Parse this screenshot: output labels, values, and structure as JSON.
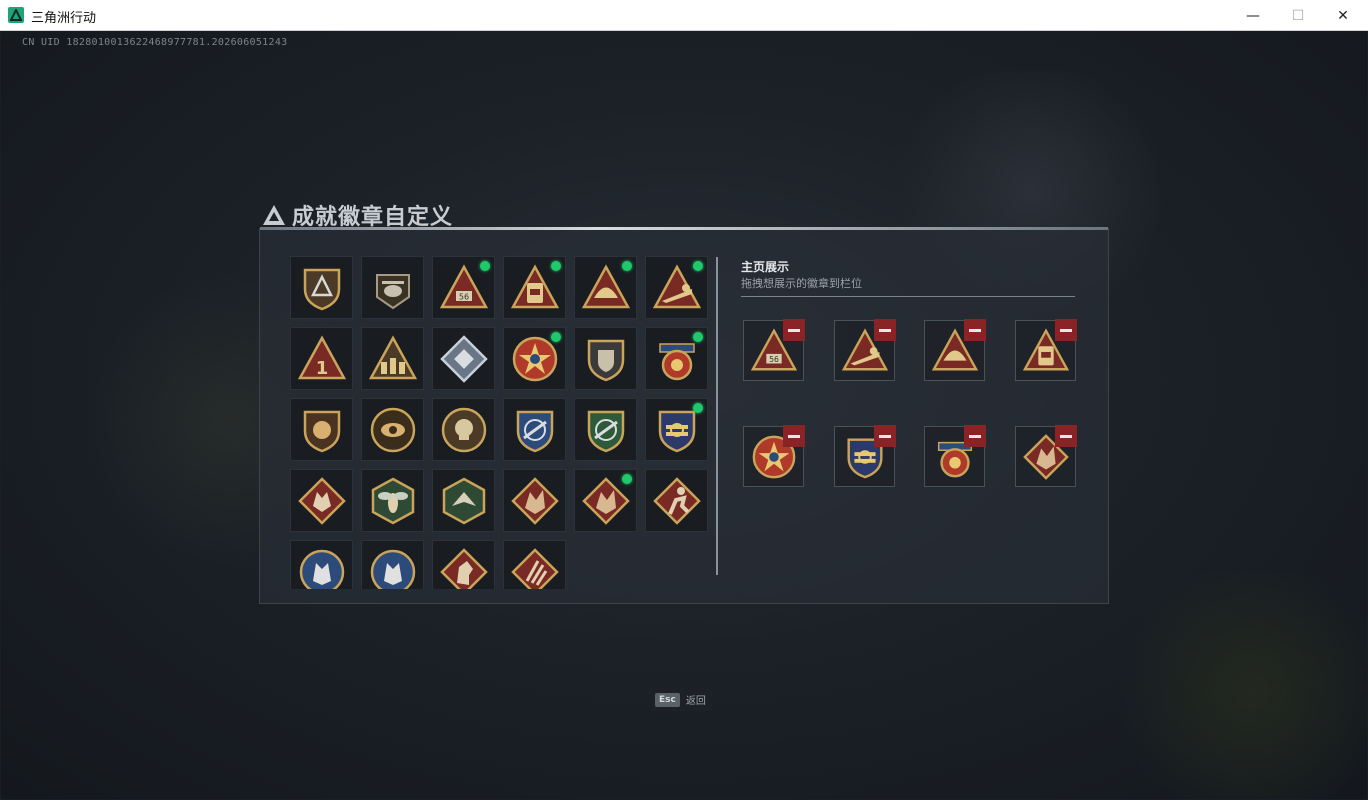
{
  "window": {
    "title": "三角洲行动",
    "minimize_glyph": "—",
    "maximize_glyph": "☐",
    "close_glyph": "✕"
  },
  "uid_text": "CN UID 1828010013622468977781.202606051243",
  "heading": {
    "text": "成就徽章自定义",
    "icon": "delta-logo-icon"
  },
  "showcase": {
    "title": "主页展示",
    "subtitle": "拖拽想展示的徽章到栏位",
    "slots": [
      {
        "badge": "triangle-56-badge",
        "remove_icon": "minus-icon"
      },
      {
        "badge": "triangle-soldier-prone-badge",
        "remove_icon": "minus-icon"
      },
      {
        "badge": "triangle-helmet-badge",
        "remove_icon": "minus-icon"
      },
      {
        "badge": "triangle-backpack-badge",
        "remove_icon": "minus-icon"
      },
      {
        "badge": "star-medal-badge",
        "remove_icon": "minus-icon"
      },
      {
        "badge": "gold-shield-crest-badge",
        "remove_icon": "minus-icon"
      },
      {
        "badge": "blue-ribbon-medal-badge",
        "remove_icon": "minus-icon"
      },
      {
        "badge": "dragon-diamond-badge",
        "remove_icon": "minus-icon"
      }
    ]
  },
  "badges": [
    {
      "icon": "triangle-shield-badge",
      "new": false
    },
    {
      "icon": "helicopter-badge",
      "new": false
    },
    {
      "icon": "triangle-56-badge",
      "new": true
    },
    {
      "icon": "triangle-backpack-badge",
      "new": true
    },
    {
      "icon": "triangle-helmet-badge",
      "new": true
    },
    {
      "icon": "triangle-soldier-prone-badge",
      "new": true
    },
    {
      "icon": "triangle-number-one-badge",
      "new": false
    },
    {
      "icon": "triangle-squad-badge",
      "new": false
    },
    {
      "icon": "silver-diamond-badge",
      "new": false
    },
    {
      "icon": "star-medal-badge",
      "new": true
    },
    {
      "icon": "shield-emblem-badge",
      "new": false
    },
    {
      "icon": "blue-ribbon-medal-badge",
      "new": true
    },
    {
      "icon": "lion-shield-badge",
      "new": false
    },
    {
      "icon": "eye-circle-badge",
      "new": false
    },
    {
      "icon": "skull-circle-badge",
      "new": false
    },
    {
      "icon": "blue-rifle-shield-badge",
      "new": false
    },
    {
      "icon": "green-rifle-shield-badge",
      "new": false
    },
    {
      "icon": "gold-shield-crest-badge",
      "new": true
    },
    {
      "icon": "wolf-diamond-badge",
      "new": false
    },
    {
      "icon": "wasp-hexagon-badge",
      "new": false
    },
    {
      "icon": "bird-hexagon-badge",
      "new": false
    },
    {
      "icon": "dragon-diamond-badge",
      "new": false
    },
    {
      "icon": "dragon-diamond-badge-2",
      "new": true
    },
    {
      "icon": "runner-diamond-badge",
      "new": false
    },
    {
      "icon": "wolf-blue-circle-badge",
      "new": false
    },
    {
      "icon": "wolf-blue-circle-badge-2",
      "new": false
    },
    {
      "icon": "horse-diamond-badge",
      "new": false
    },
    {
      "icon": "claw-diamond-badge",
      "new": false
    }
  ],
  "footer": {
    "key": "Esc",
    "label": "返回"
  },
  "colors": {
    "accent_green": "#1ec86b",
    "remove_red": "#8a2326",
    "badge_gold": "#c9a45a"
  }
}
